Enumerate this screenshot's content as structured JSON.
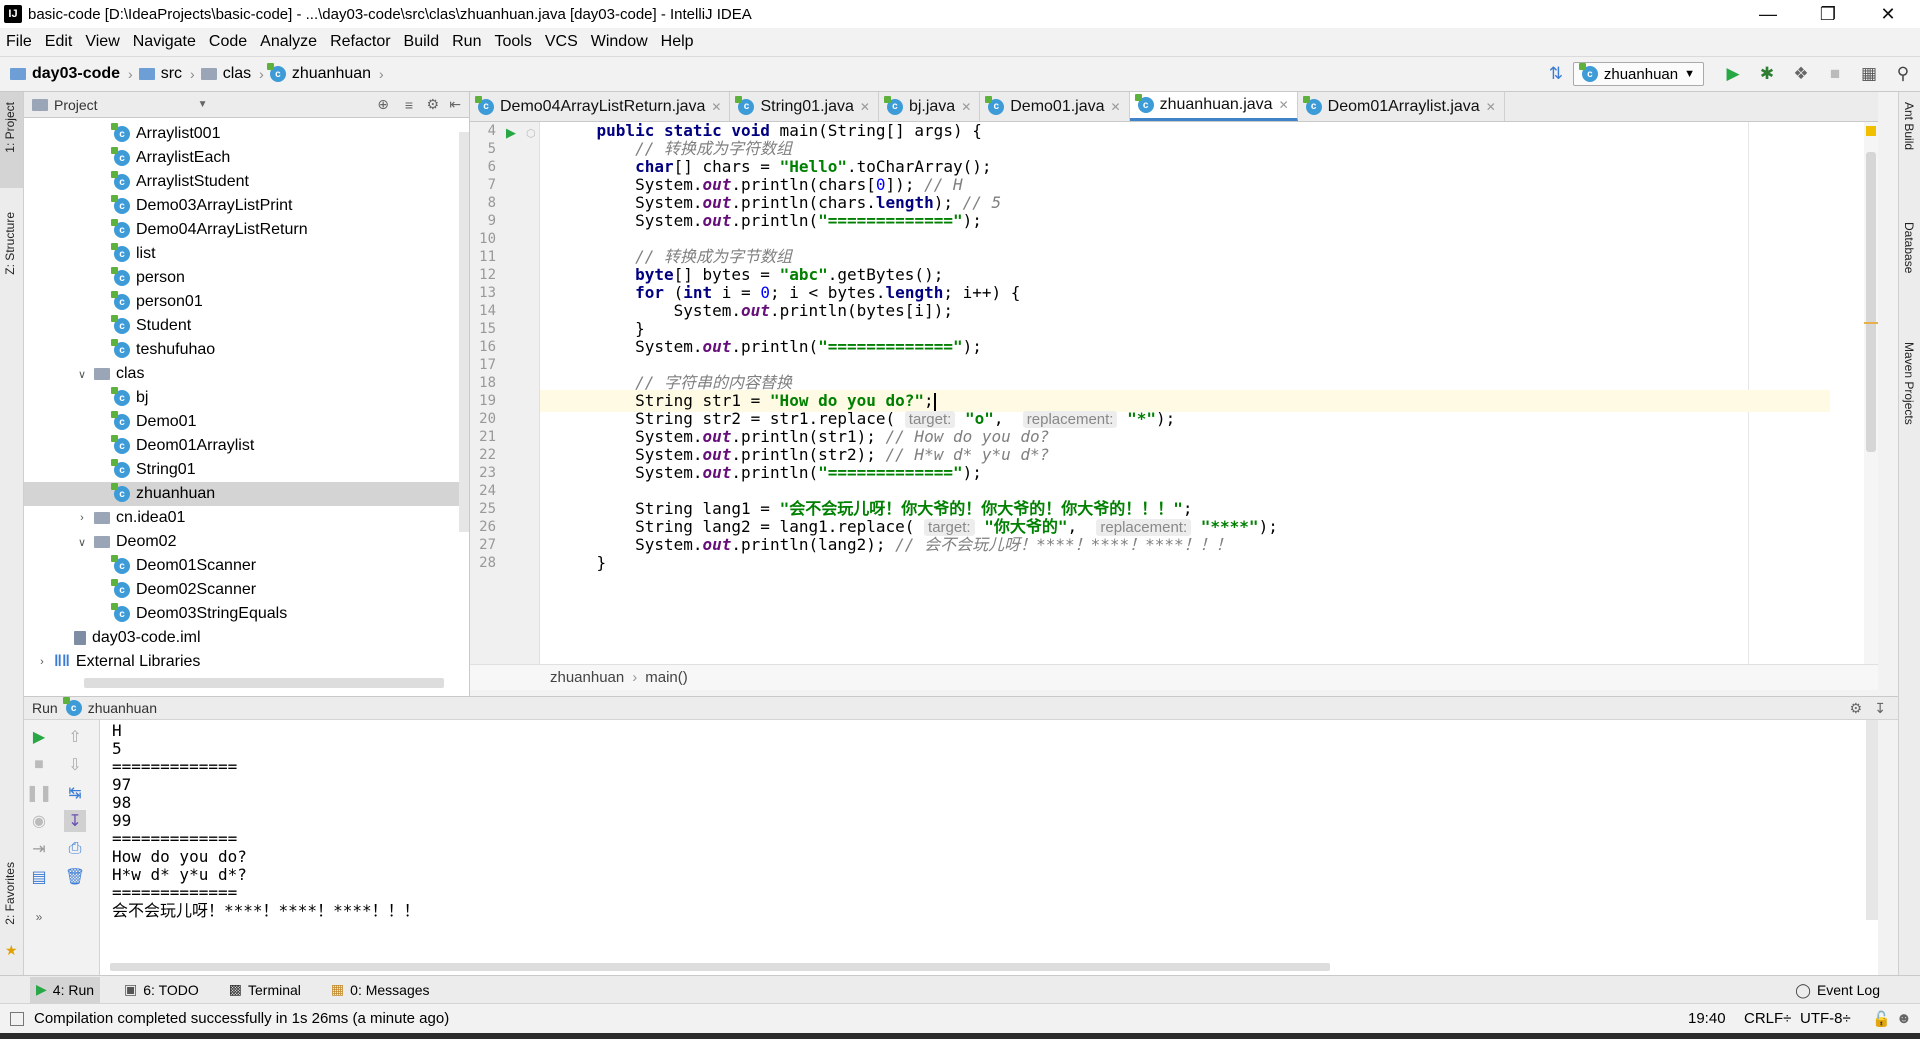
{
  "window": {
    "title": "basic-code [D:\\IdeaProjects\\basic-code] - ...\\day03-code\\src\\clas\\zhuanhuan.java [day03-code] - IntelliJ IDEA",
    "app_icon": "IJ"
  },
  "menu": [
    "File",
    "Edit",
    "View",
    "Navigate",
    "Code",
    "Analyze",
    "Refactor",
    "Build",
    "Run",
    "Tools",
    "VCS",
    "Window",
    "Help"
  ],
  "breadcrumb": [
    "day03-code",
    "src",
    "clas",
    "zhuanhuan"
  ],
  "run_config": "zhuanhuan",
  "left_tabs": {
    "project": "1: Project",
    "structure": "Z: Structure",
    "favorites": "2: Favorites"
  },
  "right_tabs": {
    "ant": "Ant Build",
    "database": "Database",
    "maven": "Maven Projects"
  },
  "project_panel": {
    "title": "Project",
    "tree": [
      {
        "label": "Arraylist001",
        "type": "class",
        "indent": 3
      },
      {
        "label": "ArraylistEach",
        "type": "class",
        "indent": 3
      },
      {
        "label": "ArraylistStudent",
        "type": "class",
        "indent": 3
      },
      {
        "label": "Demo03ArrayListPrint",
        "type": "class",
        "indent": 3
      },
      {
        "label": "Demo04ArrayListReturn",
        "type": "class",
        "indent": 3
      },
      {
        "label": "list",
        "type": "class",
        "indent": 3
      },
      {
        "label": "person",
        "type": "class",
        "indent": 3
      },
      {
        "label": "person01",
        "type": "class",
        "indent": 3
      },
      {
        "label": "Student",
        "type": "class",
        "indent": 3
      },
      {
        "label": "teshufuhao",
        "type": "class",
        "indent": 3
      },
      {
        "label": "clas",
        "type": "folder-open",
        "indent": 2
      },
      {
        "label": "bj",
        "type": "class",
        "indent": 3
      },
      {
        "label": "Demo01",
        "type": "class",
        "indent": 3
      },
      {
        "label": "Deom01Arraylist",
        "type": "class",
        "indent": 3
      },
      {
        "label": "String01",
        "type": "class",
        "indent": 3
      },
      {
        "label": "zhuanhuan",
        "type": "class",
        "indent": 3,
        "selected": true
      },
      {
        "label": "cn.idea01",
        "type": "folder-closed",
        "indent": 2
      },
      {
        "label": "Deom02",
        "type": "folder-open",
        "indent": 2
      },
      {
        "label": "Deom01Scanner",
        "type": "class",
        "indent": 3
      },
      {
        "label": "Deom02Scanner",
        "type": "class",
        "indent": 3
      },
      {
        "label": "Deom03StringEquals",
        "type": "class",
        "indent": 3
      },
      {
        "label": "day03-code.iml",
        "type": "file",
        "indent": 1
      },
      {
        "label": "External Libraries",
        "type": "lib",
        "indent": 0
      }
    ]
  },
  "editor_tabs": [
    {
      "label": "Demo04ArrayListReturn.java",
      "active": false
    },
    {
      "label": "String01.java",
      "active": false
    },
    {
      "label": "bj.java",
      "active": false
    },
    {
      "label": "Demo01.java",
      "active": false
    },
    {
      "label": "zhuanhuan.java",
      "active": true
    },
    {
      "label": "Deom01Arraylist.java",
      "active": false
    }
  ],
  "editor_breadcrumb": [
    "zhuanhuan",
    "main()"
  ],
  "code": [
    {
      "n": "4",
      "html": "    <span class='kw'>public static void</span> main(String[] args) {"
    },
    {
      "n": "5",
      "html": "        <span class='cmt'>// 转换成为字符数组</span>"
    },
    {
      "n": "6",
      "html": "        <span class='kw'>char</span>[] chars = <span class='str'>\"Hello\"</span>.toCharArray();"
    },
    {
      "n": "7",
      "html": "        System.<span class='static'>out</span>.println(chars[<span class='num'>0</span>]); <span class='cmt'>// H</span>"
    },
    {
      "n": "8",
      "html": "        System.<span class='static'>out</span>.println(chars.<span class='kw'>length</span>); <span class='cmt'>// 5</span>"
    },
    {
      "n": "9",
      "html": "        System.<span class='static'>out</span>.println(<span class='str'>\"=============\"</span>);"
    },
    {
      "n": "10",
      "html": ""
    },
    {
      "n": "11",
      "html": "        <span class='cmt'>// 转换成为字节数组</span>"
    },
    {
      "n": "12",
      "html": "        <span class='kw'>byte</span>[] bytes = <span class='str'>\"abc\"</span>.getBytes();"
    },
    {
      "n": "13",
      "html": "        <span class='kw'>for</span> (<span class='kw'>int</span> i = <span class='num'>0</span>; i &lt; bytes.<span class='kw'>length</span>; i++) {"
    },
    {
      "n": "14",
      "html": "            System.<span class='static'>out</span>.println(bytes[i]);"
    },
    {
      "n": "15",
      "html": "        }"
    },
    {
      "n": "16",
      "html": "        System.<span class='static'>out</span>.println(<span class='str'>\"=============\"</span>);"
    },
    {
      "n": "17",
      "html": ""
    },
    {
      "n": "18",
      "html": "        <span class='cmt'>// 字符串的内容替换</span>"
    },
    {
      "n": "19",
      "html": "        String str1 = <span class='str'>\"How do you do?\"</span>;<span class='caret'></span>",
      "current": true
    },
    {
      "n": "20",
      "html": "        String str2 = str1.replace( <span class='hint'>target:</span> <span class='str'>\"o\"</span>,  <span class='hint'>replacement:</span> <span class='str'>\"*\"</span>);"
    },
    {
      "n": "21",
      "html": "        System.<span class='static'>out</span>.println(str1); <span class='cmt'>// How do you do?</span>"
    },
    {
      "n": "22",
      "html": "        System.<span class='static'>out</span>.println(str2); <span class='cmt'>// H*w d* y*u d*?</span>"
    },
    {
      "n": "23",
      "html": "        System.<span class='static'>out</span>.println(<span class='str'>\"=============\"</span>);"
    },
    {
      "n": "24",
      "html": ""
    },
    {
      "n": "25",
      "html": "        String lang1 = <span class='str'>\"会不会玩儿呀！你大爷的！你大爷的！你大爷的！！！\"</span>;"
    },
    {
      "n": "26",
      "html": "        String lang2 = lang1.replace( <span class='hint'>target:</span> <span class='str'>\"你大爷的\"</span>,  <span class='hint'>replacement:</span> <span class='str'>\"****\"</span>);"
    },
    {
      "n": "27",
      "html": "        System.<span class='static'>out</span>.println(lang2); <span class='cmt'>// 会不会玩儿呀！****！****！****！！！</span>"
    },
    {
      "n": "28",
      "html": "    }"
    }
  ],
  "run_panel": {
    "label": "Run",
    "config": "zhuanhuan",
    "output": [
      "H",
      "5",
      "=============",
      "97",
      "98",
      "99",
      "=============",
      "How do you do?",
      "H*w d* y*u d*?",
      "=============",
      "会不会玩儿呀！****！****！****！！！"
    ]
  },
  "bottom_tabs": [
    {
      "label": "4: Run",
      "icon": "play-icon",
      "active": true
    },
    {
      "label": "6: TODO",
      "icon": "todo-icon",
      "active": false
    },
    {
      "label": "Terminal",
      "icon": "terminal-icon",
      "active": false
    },
    {
      "label": "0: Messages",
      "icon": "messages-icon",
      "active": false
    }
  ],
  "event_log": "Event Log",
  "status": {
    "message": "Compilation completed successfully in 1s 26ms (a minute ago)",
    "position": "19:40",
    "line_sep": "CRLF÷",
    "encoding": "UTF-8÷"
  },
  "colors": {
    "accent": "#4083c9",
    "run_green": "#28a745",
    "selected_row": "#d4d4d4",
    "current_line": "#fffae3"
  }
}
